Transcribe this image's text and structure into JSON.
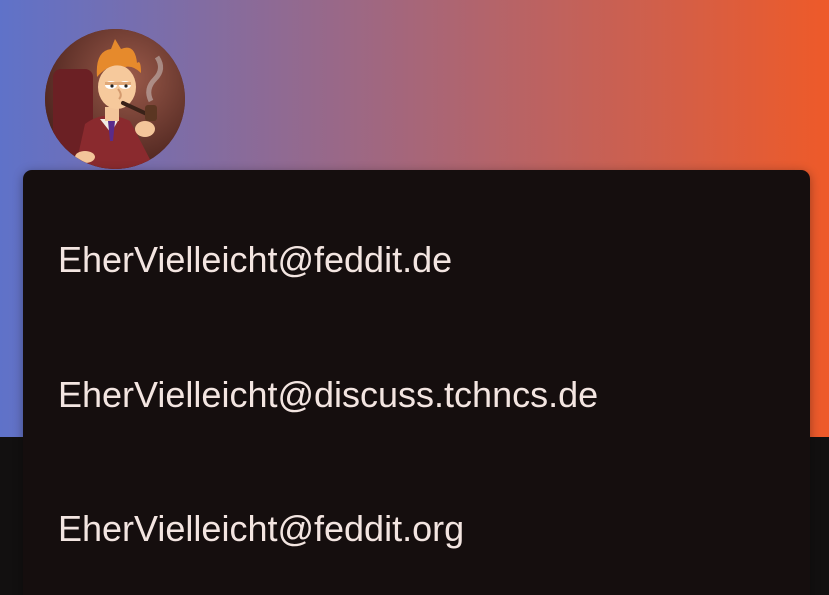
{
  "banner": {
    "gradient_start": "#5f72c9",
    "gradient_end": "#ee5a29"
  },
  "avatar": {
    "icon": "user-avatar-icon"
  },
  "account_menu": {
    "items": [
      {
        "label": "EherVielleicht@feddit.de"
      },
      {
        "label": "EherVielleicht@discuss.tchncs.de"
      },
      {
        "label": "EherVielleicht@feddit.org"
      }
    ]
  },
  "colors": {
    "menu_background": "#150e0e",
    "menu_text": "#f3e5e1",
    "page_background": "#121010"
  }
}
